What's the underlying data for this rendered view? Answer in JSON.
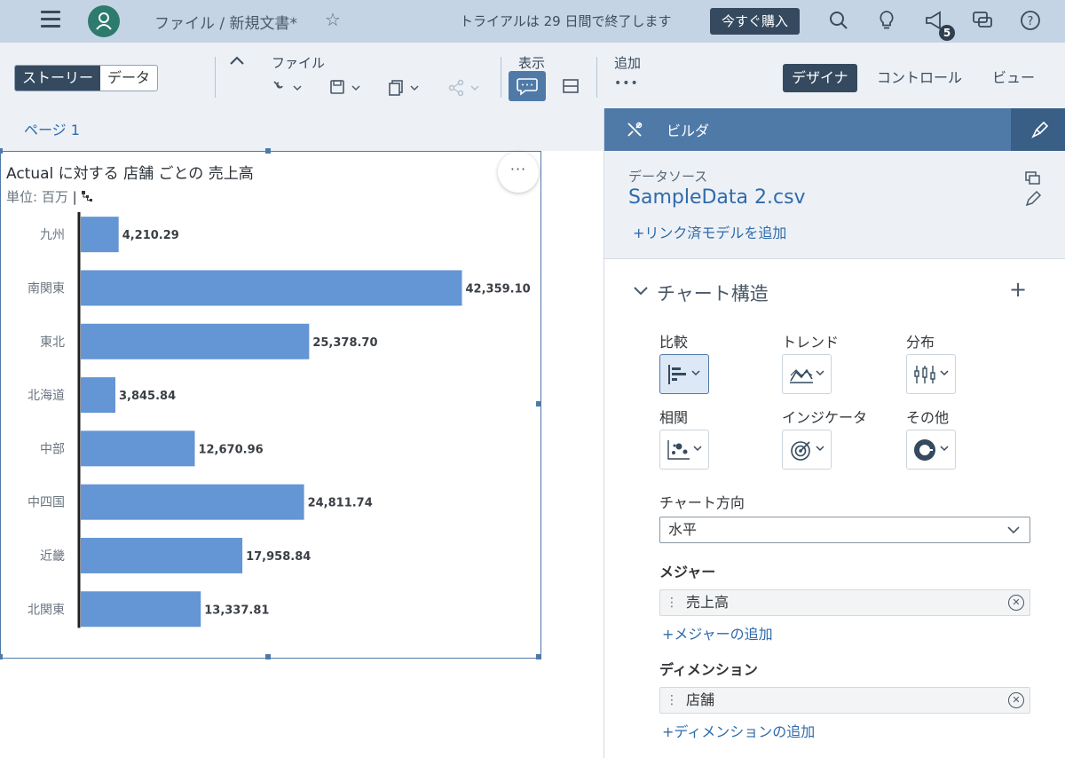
{
  "shell": {
    "breadcrumb": "ファイル / 新規文書*",
    "trial_text": "トライアルは 29 日間で終了します",
    "buy_label": "今すぐ購入",
    "notification_count": "5",
    "icons": [
      "menu-icon",
      "avatar",
      "star-icon",
      "search-icon",
      "lightbulb-icon",
      "megaphone-icon",
      "chat-icon",
      "help-icon"
    ]
  },
  "toolbar": {
    "story_tab": "ストーリー",
    "data_tab": "データ",
    "file_label": "ファイル",
    "view_label": "表示",
    "add_label": "追加",
    "designer_label": "デザイナ",
    "control_label": "コントロール",
    "view_mode_label": "ビュー"
  },
  "page": {
    "tab_label": "ページ 1"
  },
  "widget": {
    "title": "Actual に対する 店舗 ごとの 売上高",
    "unit": "単位: 百万",
    "more_label": "···"
  },
  "chart_data": {
    "type": "bar",
    "orientation": "horizontal",
    "categories": [
      "九州",
      "南関東",
      "東北",
      "北海道",
      "中部",
      "中四国",
      "近畿",
      "北関東"
    ],
    "values": [
      4210.29,
      42359.1,
      25378.7,
      3845.84,
      12670.96,
      24811.74,
      17958.84,
      13337.81
    ],
    "value_labels": [
      "4,210.29",
      "42,359.10",
      "25,378.70",
      "3,845.84",
      "12,670.96",
      "24,811.74",
      "17,958.84",
      "13,337.81"
    ],
    "title": "Actual に対する 店舗 ごとの 売上高",
    "xlim": [
      0,
      50000
    ],
    "bar_color": "#6495d4",
    "grid": false,
    "legend": "none"
  },
  "builder": {
    "header": "ビルダ",
    "datasource_label": "データソース",
    "datasource_name": "SampleData 2.csv",
    "add_linked_model": "+リンク済モデルを追加",
    "chart_structure": "チャート構造",
    "chart_types": [
      {
        "label": "比較",
        "icon": "bar-chart-icon",
        "selected": true
      },
      {
        "label": "トレンド",
        "icon": "area-chart-icon",
        "selected": false
      },
      {
        "label": "分布",
        "icon": "boxplot-icon",
        "selected": false
      },
      {
        "label": "相関",
        "icon": "scatter-icon",
        "selected": false
      },
      {
        "label": "インジケータ",
        "icon": "target-icon",
        "selected": false
      },
      {
        "label": "その他",
        "icon": "donut-icon",
        "selected": false
      }
    ],
    "orientation_label": "チャート方向",
    "orientation_value": "水平",
    "measures_label": "メジャー",
    "measure": "売上高",
    "add_measure": "+メジャーの追加",
    "dimensions_label": "ディメンション",
    "dimension": "店舗",
    "add_dimension": "+ディメンションの追加"
  },
  "colors": {
    "accent": "#354a5f",
    "shell": "#c5d4e4",
    "link": "#2f6bab",
    "panel_header": "#4f7aa8"
  }
}
